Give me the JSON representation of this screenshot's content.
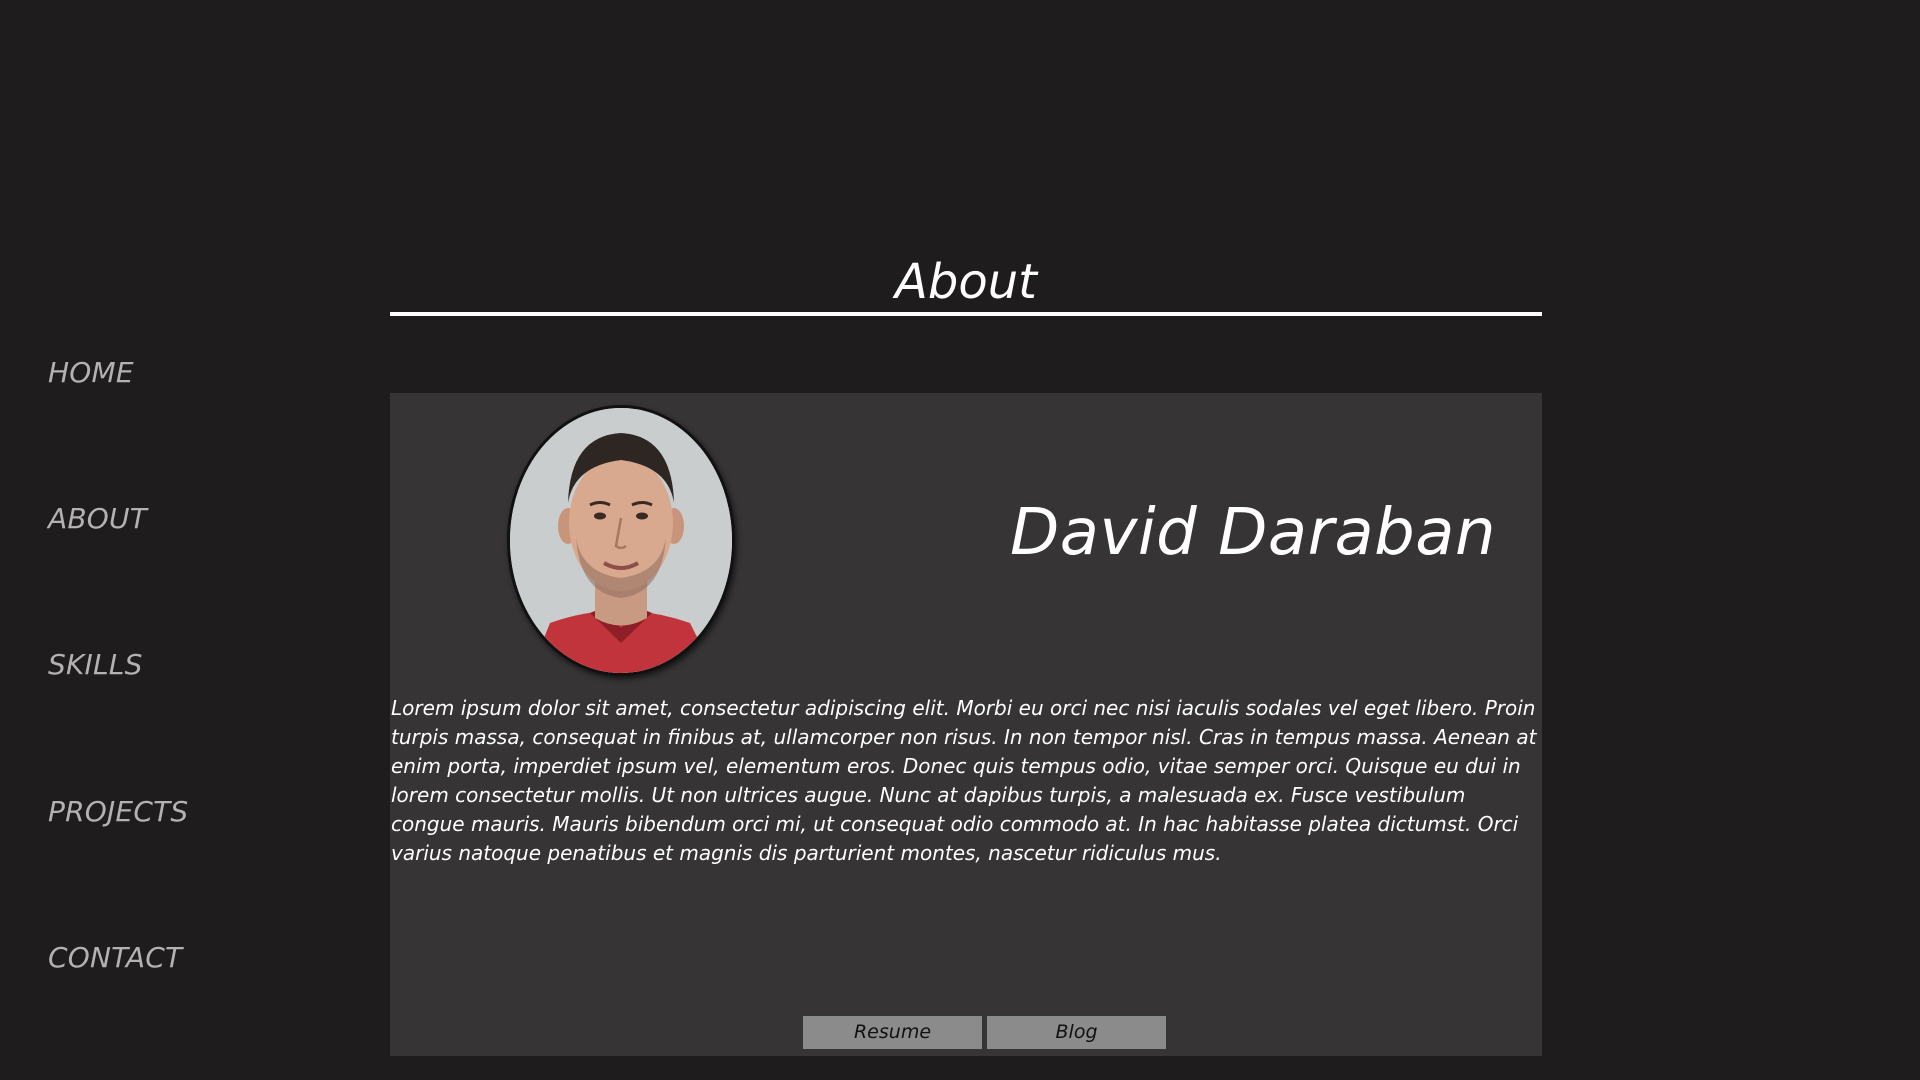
{
  "nav": {
    "items": [
      {
        "label": "HOME"
      },
      {
        "label": "ABOUT"
      },
      {
        "label": "SKILLS"
      },
      {
        "label": "PROJECTS"
      },
      {
        "label": "CONTACT"
      }
    ]
  },
  "section": {
    "title": "About"
  },
  "profile": {
    "name": "David Daraban",
    "photo_icon": "profile-photo",
    "bio": "Lorem ipsum dolor sit amet, consectetur adipiscing elit. Morbi eu orci nec nisi iaculis sodales vel eget libero. Proin turpis massa, consequat in finibus at, ullamcorper non risus. In non tempor nisl. Cras in tempus massa. Aenean at enim porta, imperdiet ipsum vel, elementum eros. Donec quis tempus odio, vitae semper orci. Quisque eu dui in lorem consectetur mollis. Ut non ultrices augue. Nunc at dapibus turpis, a malesuada ex. Fusce vestibulum congue mauris. Mauris bibendum orci mi, ut consequat odio commodo at. In hac habitasse platea dictumst. Orci varius natoque penatibus et magnis dis parturient montes, nascetur ridiculus mus."
  },
  "buttons": {
    "resume_label": "Resume",
    "blog_label": "Blog"
  },
  "colors": {
    "background": "#1e1c1d",
    "card": "#363435",
    "nav_text": "#b3b1b2",
    "button": "#8c8b8b"
  }
}
